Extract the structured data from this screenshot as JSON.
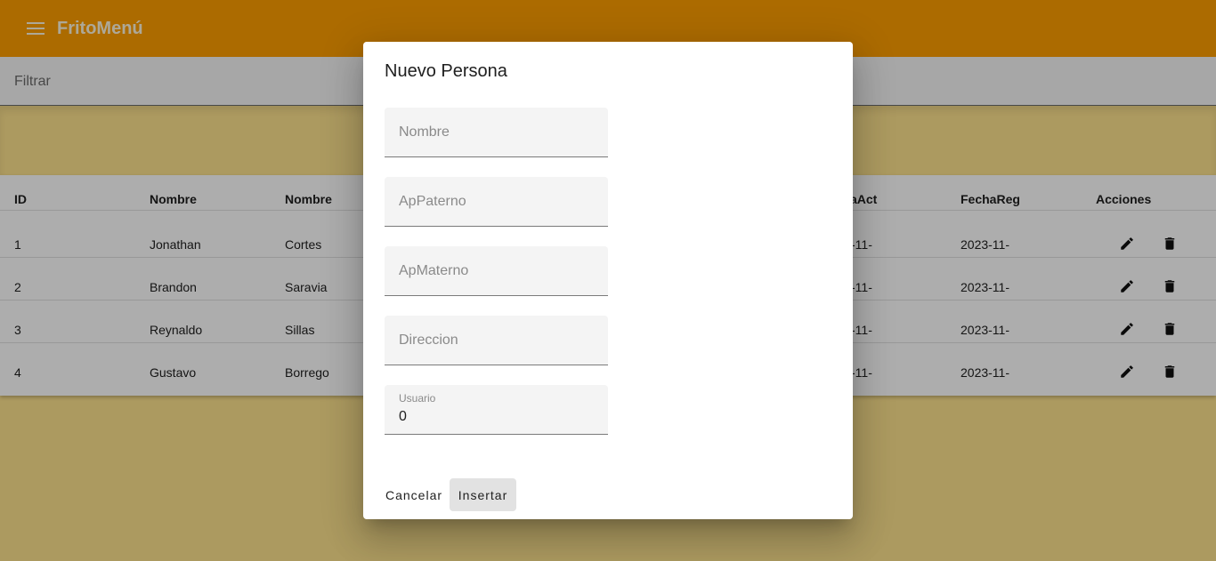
{
  "app": {
    "title": "FritoMenú",
    "menu_icon": "menu-icon"
  },
  "filter": {
    "label": "Filtrar"
  },
  "table": {
    "headers": [
      "ID",
      "Nombre",
      "Nombre",
      "aAct",
      "FechaReg",
      "Acciones"
    ],
    "rows": [
      {
        "id": "1",
        "nombre": "Jonathan",
        "ap": "Cortes",
        "fecha_act": "-11-",
        "fecha_reg": "2023-11-"
      },
      {
        "id": "2",
        "nombre": "Brandon",
        "ap": "Saravia",
        "fecha_act": "-11-",
        "fecha_reg": "2023-11-"
      },
      {
        "id": "3",
        "nombre": "Reynaldo",
        "ap": "Sillas",
        "fecha_act": "-11-",
        "fecha_reg": "2023-11-"
      },
      {
        "id": "4",
        "nombre": "Gustavo",
        "ap": "Borrego",
        "fecha_act": "-11-",
        "fecha_reg": "2023-11-"
      }
    ],
    "edit_icon": "pencil-icon",
    "delete_icon": "trash-icon"
  },
  "dialog": {
    "title": "Nuevo Persona",
    "fields": [
      {
        "label": "Nombre",
        "value": ""
      },
      {
        "label": "ApPaterno",
        "value": ""
      },
      {
        "label": "ApMaterno",
        "value": ""
      },
      {
        "label": "Direccion",
        "value": ""
      },
      {
        "label": "Usuario",
        "value": "0"
      }
    ],
    "cancel_label": "Cancelar",
    "insert_label": "Insertar"
  },
  "colors": {
    "toolbar": "#fe9e00",
    "page": "#fee38e"
  }
}
